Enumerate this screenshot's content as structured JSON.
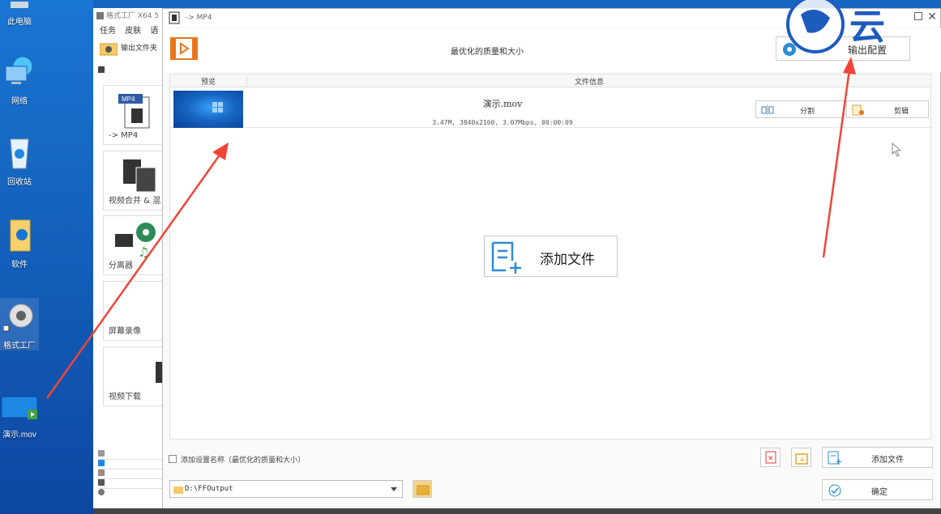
{
  "desktop": {
    "icons": [
      {
        "label": "此电脑"
      },
      {
        "label": "网络"
      },
      {
        "label": "回收站"
      },
      {
        "label": "软件"
      },
      {
        "label": "格式工厂"
      },
      {
        "label": "演示.mov"
      }
    ]
  },
  "app": {
    "title": "格式工厂 X64 5",
    "menus": [
      "任务",
      "皮肤",
      "语"
    ],
    "output_folder_label": "输出文件夹",
    "tools": [
      {
        "label": "-> MP4",
        "badge": "MP4"
      },
      {
        "label": "视频合并 & 混"
      },
      {
        "label": "分离器"
      },
      {
        "label": "屏幕录像"
      },
      {
        "label": "视频下载"
      }
    ]
  },
  "dialog": {
    "title": "-> MP4",
    "center_title": "最优化的质量和大小",
    "output_config_label": "输出配置",
    "table": {
      "col_preview": "预览",
      "col_info": "文件信息",
      "row": {
        "filename": "演示.mov",
        "info": "3.47M, 3840x2160, 3.07Mbps, 00:00:09",
        "split_label": "分割",
        "clip_label": "剪辑"
      }
    },
    "add_file_center_label": "添加文件",
    "save_setting_label": "添加设置名称〔最优化的质量和大小〕",
    "add_file_label": "添加文件",
    "ok_label": "确定",
    "output_path": "D:\\FFOutput"
  },
  "colors": {
    "arrow": "#f04438",
    "accent": "#e8761a",
    "blue_icon": "#2a8bd8"
  }
}
